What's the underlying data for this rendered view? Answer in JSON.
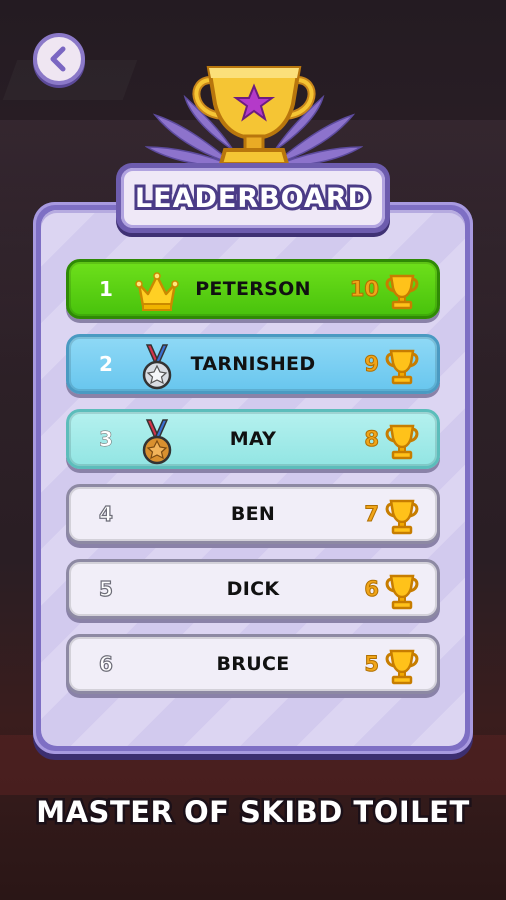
{
  "header": {
    "back_button": "back-icon",
    "title": "LEADERBOARD"
  },
  "colors": {
    "panel": "#7e6fc4",
    "first_place": "#48c20c",
    "second_place": "#68c6ee",
    "third_place": "#92e5e3",
    "default_row": "#f1eef8",
    "score": "#f0a51a"
  },
  "leaderboard": [
    {
      "rank": "1",
      "badge": "crown-icon",
      "name": "PETERSON",
      "score": "10"
    },
    {
      "rank": "2",
      "badge": "silver-medal-icon",
      "name": "TARNISHED",
      "score": "9"
    },
    {
      "rank": "3",
      "badge": "bronze-medal-icon",
      "name": "MAY",
      "score": "8"
    },
    {
      "rank": "4",
      "badge": "",
      "name": "BEN",
      "score": "7"
    },
    {
      "rank": "5",
      "badge": "",
      "name": "DICK",
      "score": "6"
    },
    {
      "rank": "6",
      "badge": "",
      "name": "BRUCE",
      "score": "5"
    }
  ],
  "footer": {
    "subtitle": "MASTER OF SKIBD TOILET"
  }
}
